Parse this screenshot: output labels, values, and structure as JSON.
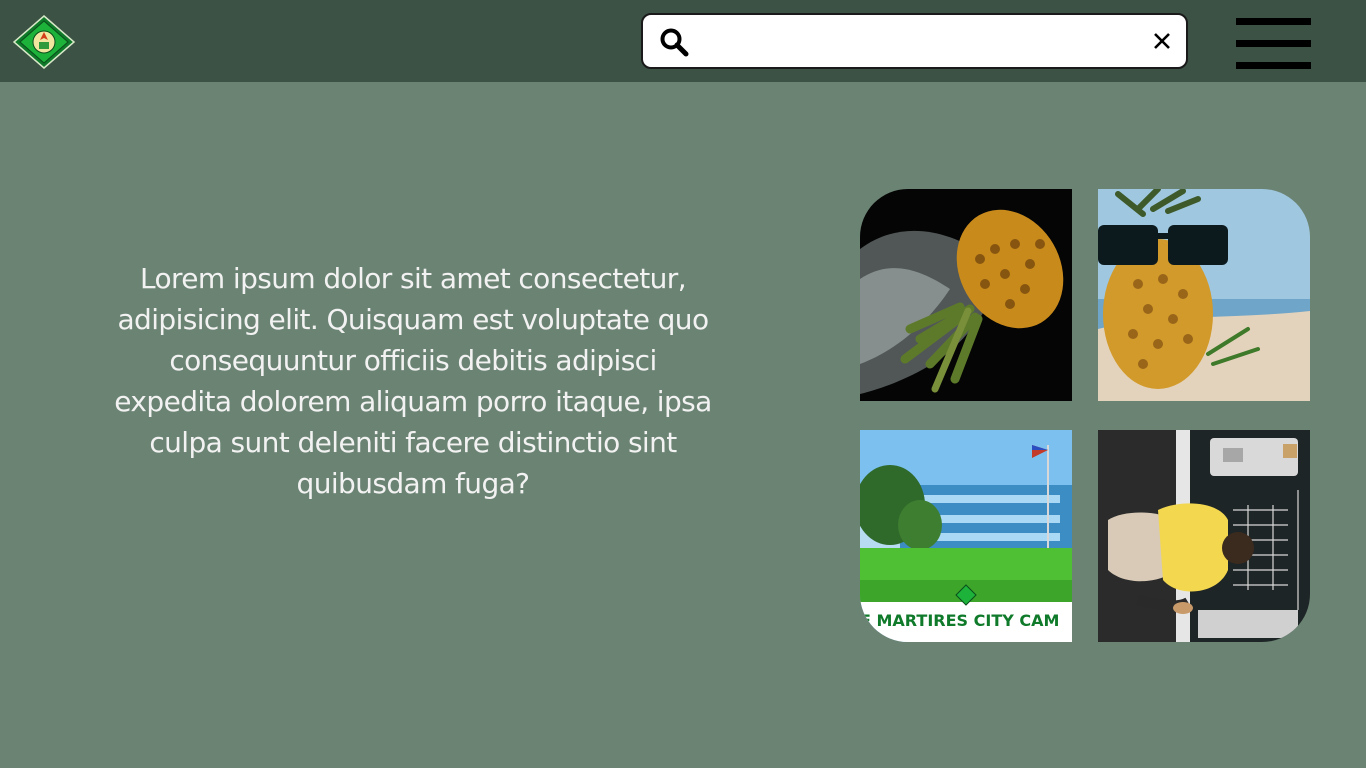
{
  "header": {
    "logo_icon": "school-seal-logo",
    "search": {
      "value": "",
      "placeholder": "",
      "search_icon": "magnifier-icon",
      "clear_icon": "close-icon"
    },
    "menu_icon": "hamburger-menu-icon"
  },
  "main": {
    "intro_text": "Lorem ipsum dolor sit amet consectetur, adipisicing elit. Quisquam est voluptate quo consequuntur officiis debitis adipisci expedita dolorem aliquam porro itaque, ipsa culpa sunt deleniti facere distinctio sint quibusdam fuga?",
    "gallery": [
      {
        "name": "pineapple-splash-photo"
      },
      {
        "name": "pineapple-sunglasses-beach-photo"
      },
      {
        "name": "campus-building-photo",
        "banner_text": "E MARTIRES CITY CAM"
      },
      {
        "name": "person-at-chalkboard-photo"
      }
    ]
  },
  "colors": {
    "page_background": "#6b8373",
    "header_background": "#3b5245",
    "text": "#f2f2f2",
    "logo_green": "#1db33a"
  }
}
